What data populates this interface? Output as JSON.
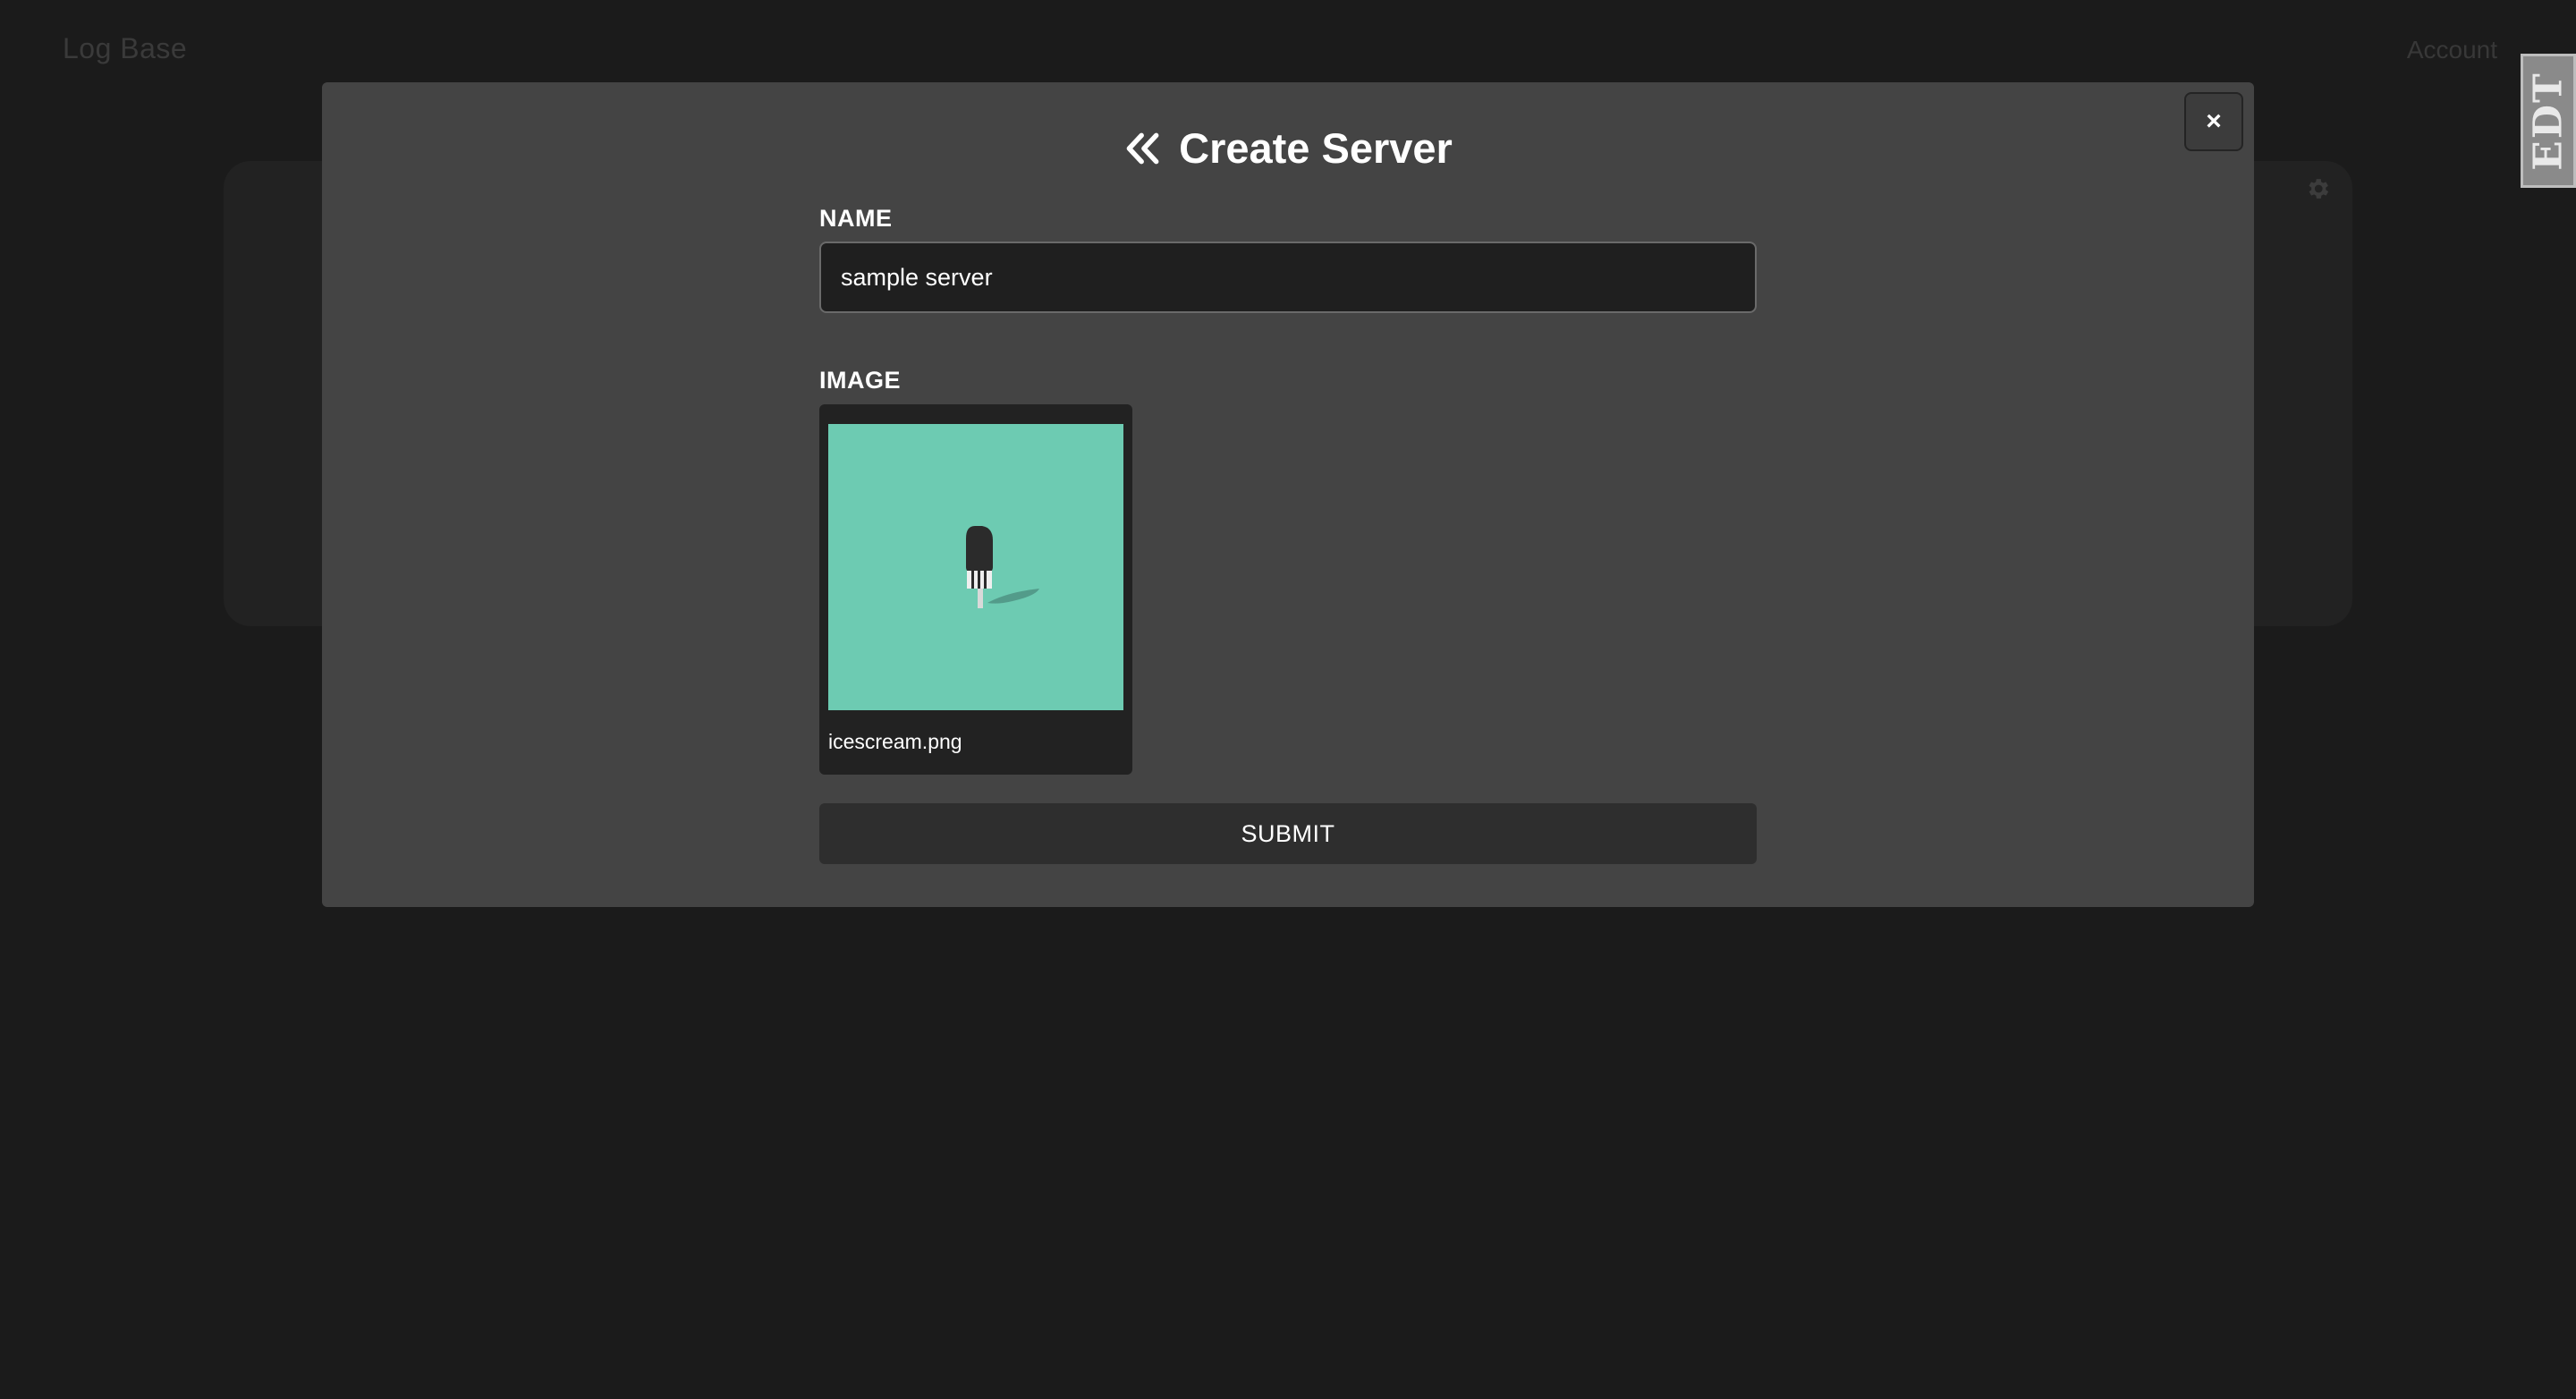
{
  "app": {
    "logo": "Log Base",
    "account_link": "Account",
    "badge": "EDT"
  },
  "modal": {
    "title": "Create Server",
    "close_label": "×",
    "name_label": "NAME",
    "name_value": "sample server",
    "image_label": "IMAGE",
    "image_filename": "icescream.png",
    "submit_label": "SUBMIT"
  },
  "icons": {
    "back": "double-chevron-left-icon",
    "close": "close-icon",
    "settings": "gear-icon"
  },
  "colors": {
    "page_bg": "#1b1b1b",
    "modal_bg": "#444444",
    "input_bg": "#1f1f1f",
    "image_bg": "#6dcbb2",
    "submit_bg": "#2e2e2e",
    "text": "#ffffff"
  }
}
